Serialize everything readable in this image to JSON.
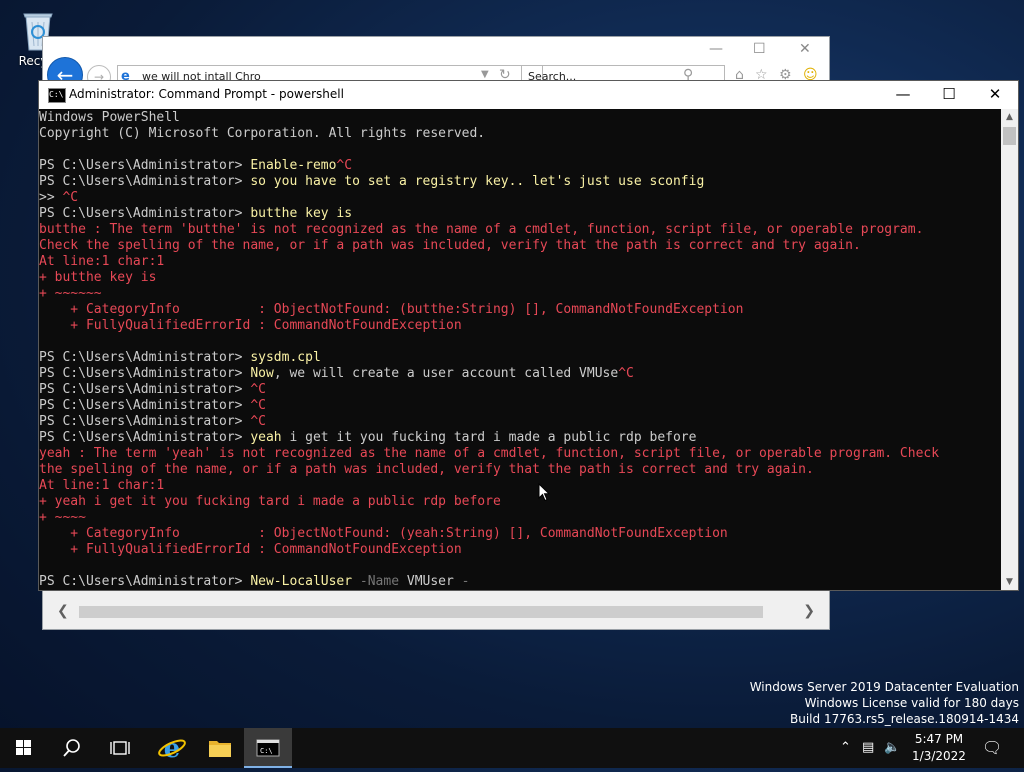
{
  "desktop": {
    "recycle_label": "Recycl"
  },
  "ie": {
    "address": "we will not intall Chro",
    "search_placeholder": "Search..."
  },
  "console": {
    "title": "Administrator: Command Prompt - powershell",
    "lines": [
      {
        "segs": [
          [
            "txt",
            "Windows PowerShell"
          ]
        ]
      },
      {
        "segs": [
          [
            "txt",
            "Copyright (C) Microsoft Corporation. All rights reserved."
          ]
        ]
      },
      {
        "segs": [
          [
            "txt",
            ""
          ]
        ]
      },
      {
        "segs": [
          [
            "txt",
            "PS C:\\Users\\Administrator> "
          ],
          [
            "cmd",
            "Enable-remo"
          ],
          [
            "err",
            "^C"
          ]
        ]
      },
      {
        "segs": [
          [
            "txt",
            "PS C:\\Users\\Administrator> "
          ],
          [
            "cmd",
            "so you have to set a registry key.. let's just use sconfig"
          ]
        ]
      },
      {
        "segs": [
          [
            "txt",
            ">> "
          ],
          [
            "err",
            "^C"
          ]
        ]
      },
      {
        "segs": [
          [
            "txt",
            "PS C:\\Users\\Administrator> "
          ],
          [
            "cmd",
            "butthe key is"
          ]
        ]
      },
      {
        "err": true,
        "segs": [
          [
            "err",
            "butthe : The term 'butthe' is not recognized as the name of a cmdlet, function, script file, or operable program."
          ]
        ]
      },
      {
        "err": true,
        "segs": [
          [
            "err",
            "Check the spelling of the name, or if a path was included, verify that the path is correct and try again."
          ]
        ]
      },
      {
        "err": true,
        "segs": [
          [
            "err",
            "At line:1 char:1"
          ]
        ]
      },
      {
        "err": true,
        "segs": [
          [
            "err",
            "+ butthe key is"
          ]
        ]
      },
      {
        "err": true,
        "segs": [
          [
            "err",
            "+ ~~~~~~"
          ]
        ]
      },
      {
        "err": true,
        "segs": [
          [
            "err",
            "    + CategoryInfo          : ObjectNotFound: (butthe:String) [], CommandNotFoundException"
          ]
        ]
      },
      {
        "err": true,
        "segs": [
          [
            "err",
            "    + FullyQualifiedErrorId : CommandNotFoundException"
          ]
        ]
      },
      {
        "segs": [
          [
            "txt",
            ""
          ]
        ]
      },
      {
        "segs": [
          [
            "txt",
            "PS C:\\Users\\Administrator> "
          ],
          [
            "cmd",
            "sysdm.cpl"
          ]
        ]
      },
      {
        "segs": [
          [
            "txt",
            "PS C:\\Users\\Administrator> "
          ],
          [
            "cmd",
            "Now"
          ],
          [
            "txt",
            ", we will create a user account called VMUse"
          ],
          [
            "err",
            "^C"
          ]
        ]
      },
      {
        "segs": [
          [
            "txt",
            "PS C:\\Users\\Administrator> "
          ],
          [
            "err",
            "^C"
          ]
        ]
      },
      {
        "segs": [
          [
            "txt",
            "PS C:\\Users\\Administrator> "
          ],
          [
            "err",
            "^C"
          ]
        ]
      },
      {
        "segs": [
          [
            "txt",
            "PS C:\\Users\\Administrator> "
          ],
          [
            "err",
            "^C"
          ]
        ]
      },
      {
        "segs": [
          [
            "txt",
            "PS C:\\Users\\Administrator> "
          ],
          [
            "cmd",
            "yeah"
          ],
          [
            "txt",
            " i get it you fucking tard i made a public rdp before"
          ]
        ]
      },
      {
        "err": true,
        "segs": [
          [
            "err",
            "yeah : The term 'yeah' is not recognized as the name of a cmdlet, function, script file, or operable program. Check"
          ]
        ]
      },
      {
        "err": true,
        "segs": [
          [
            "err",
            "the spelling of the name, or if a path was included, verify that the path is correct and try again."
          ]
        ]
      },
      {
        "err": true,
        "segs": [
          [
            "err",
            "At line:1 char:1"
          ]
        ]
      },
      {
        "err": true,
        "segs": [
          [
            "err",
            "+ yeah i get it you fucking tard i made a public rdp before"
          ]
        ]
      },
      {
        "err": true,
        "segs": [
          [
            "err",
            "+ ~~~~"
          ]
        ]
      },
      {
        "err": true,
        "segs": [
          [
            "err",
            "    + CategoryInfo          : ObjectNotFound: (yeah:String) [], CommandNotFoundException"
          ]
        ]
      },
      {
        "err": true,
        "segs": [
          [
            "err",
            "    + FullyQualifiedErrorId : CommandNotFoundException"
          ]
        ]
      },
      {
        "segs": [
          [
            "txt",
            ""
          ]
        ]
      },
      {
        "segs": [
          [
            "txt",
            "PS C:\\Users\\Administrator> "
          ],
          [
            "cmd",
            "New-LocalUser"
          ],
          [
            "txt",
            " "
          ],
          [
            "par",
            "-Name"
          ],
          [
            "txt",
            " VMUser "
          ],
          [
            "par",
            "-"
          ]
        ]
      }
    ]
  },
  "watermark": {
    "line1": "Windows Server 2019 Datacenter Evaluation",
    "line2": "Windows License valid for 180 days",
    "line3": "Build 17763.rs5_release.180914-1434"
  },
  "clock": {
    "time": "5:47 PM",
    "date": "1/3/2022"
  },
  "colors": {
    "console_bg": "#0c0c0c",
    "console_text": "#cccccc",
    "command": "#f9f1a5",
    "error": "#e74856",
    "parameter": "#767676",
    "taskbar": "#101010"
  }
}
